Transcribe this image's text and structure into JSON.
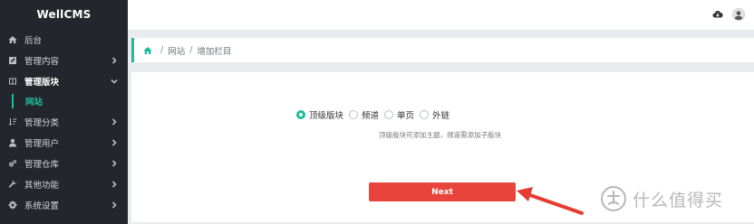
{
  "brand": "WellCMS",
  "sidebar": {
    "items": [
      {
        "label": "后台",
        "icon": "home-icon",
        "has_chevron": false
      },
      {
        "label": "管理内容",
        "icon": "edit-icon",
        "has_chevron": true
      },
      {
        "label": "管理版块",
        "icon": "columns-icon",
        "has_chevron": true,
        "active": true
      },
      {
        "label": "管理分类",
        "icon": "sort-icon",
        "has_chevron": true
      },
      {
        "label": "管理用户",
        "icon": "user-icon",
        "has_chevron": true
      },
      {
        "label": "管理仓库",
        "icon": "cogs-icon",
        "has_chevron": true
      },
      {
        "label": "其他功能",
        "icon": "wrench-icon",
        "has_chevron": true
      },
      {
        "label": "系统设置",
        "icon": "gear-icon",
        "has_chevron": true
      }
    ],
    "subitem": "网站"
  },
  "breadcrumb": {
    "icon": "home-icon",
    "items": [
      "网站",
      "增加栏目"
    ]
  },
  "form": {
    "options": [
      "顶级版块",
      "频道",
      "单页",
      "外链"
    ],
    "selected": "顶级版块",
    "hint": "顶级版块可添加主题，频道需添加子版块",
    "next_label": "Next"
  },
  "watermark": "什么值得买",
  "colors": {
    "accent": "#1abc9c",
    "button": "#e9443b",
    "sidebar_bg": "#23262c",
    "arrow": "#e63b2e"
  }
}
